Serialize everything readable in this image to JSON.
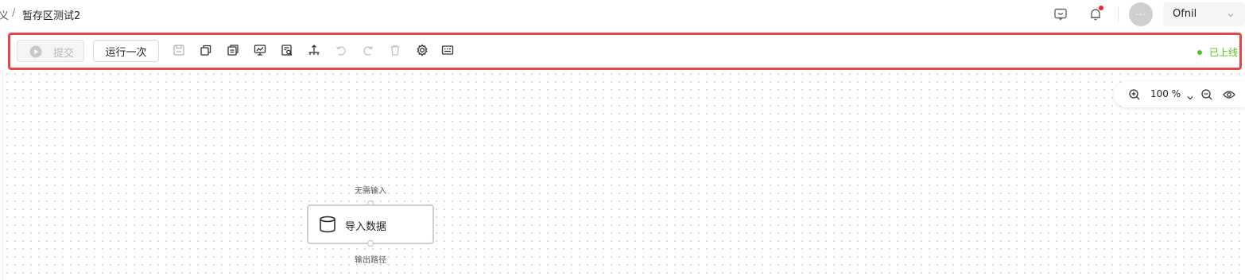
{
  "header": {
    "breadcrumb_prev": "义",
    "breadcrumb_sep": "/",
    "breadcrumb_current": "暂存区测试2",
    "user": {
      "avatar_text": "---",
      "name": "Ofnil"
    },
    "icons": [
      "chat-icon",
      "bell-icon",
      "chevron-down-icon"
    ],
    "has_notification": true
  },
  "toolbar": {
    "submit_label": "提交",
    "run_once_label": "运行一次",
    "icons": [
      "save-icon",
      "copy-icon",
      "paste-icon",
      "monitor-icon",
      "inspect-icon",
      "publish-icon",
      "undo-icon",
      "redo-icon",
      "delete-icon",
      "settings-icon",
      "terminal-icon"
    ],
    "status_label": "已上线",
    "status_color": "#52c41a",
    "highlight_color": "#e84545"
  },
  "zoom": {
    "value": "100 %"
  },
  "node": {
    "label": "导入数据",
    "icon": "database-icon",
    "input_label": "无需输入",
    "output_label": "输出路径"
  }
}
